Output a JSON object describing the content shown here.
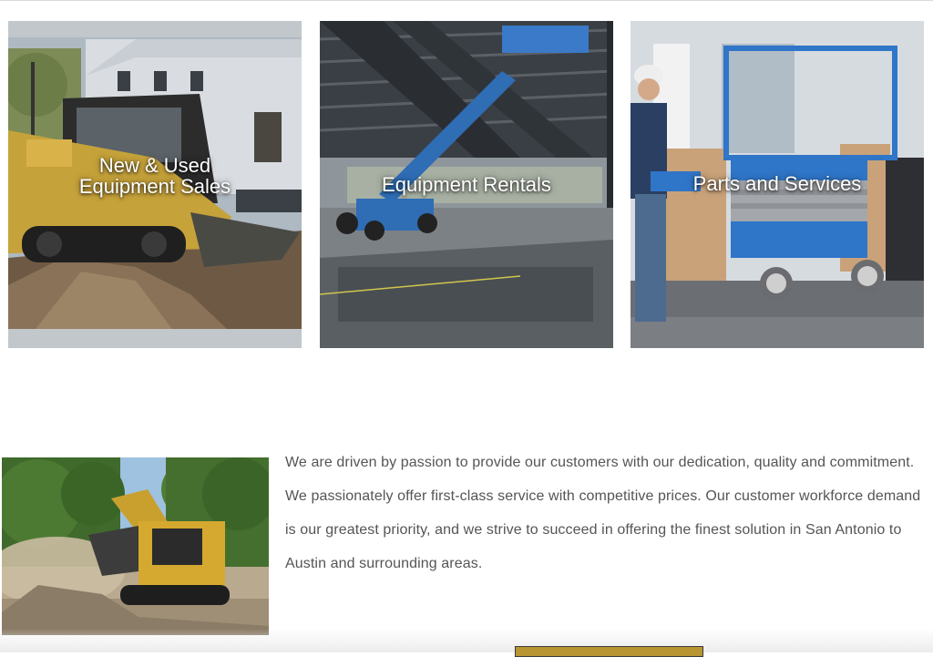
{
  "services": [
    {
      "line1": "New & Used",
      "line2": "Equipment Sales"
    },
    {
      "line1": "Equipment Rentals"
    },
    {
      "line1": "Parts and Services"
    }
  ],
  "about": {
    "text": "We are driven by passion to provide our customers with our dedication, quality and commitment. We passionately offer first-class service with competitive prices. Our customer workforce demand is our greatest priority, and we strive to succeed in offering the finest solution in San Antonio to Austin and surrounding areas."
  },
  "colors": {
    "cta": "#b89530",
    "text": "#555555"
  }
}
